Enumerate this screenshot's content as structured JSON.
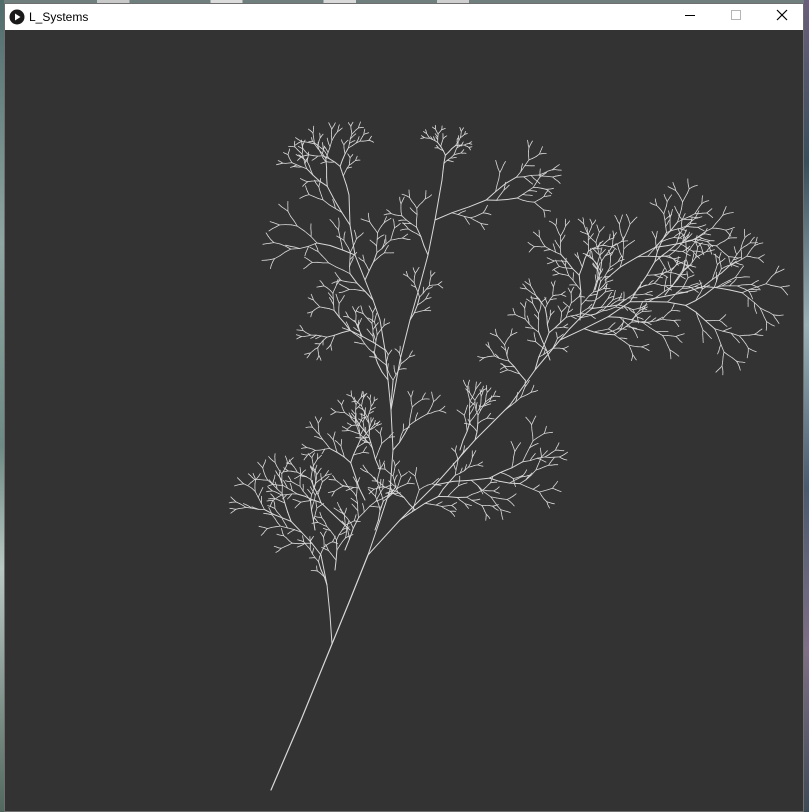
{
  "window": {
    "title": "L_Systems",
    "app_icon": "play-circle-icon",
    "controls": {
      "minimize": "minimize-icon",
      "maximize": "maximize-icon",
      "close": "close-icon"
    }
  },
  "canvas": {
    "background": "#333333",
    "stroke_color": "#d8d8d8",
    "content": "l-system-fractal-tree"
  }
}
